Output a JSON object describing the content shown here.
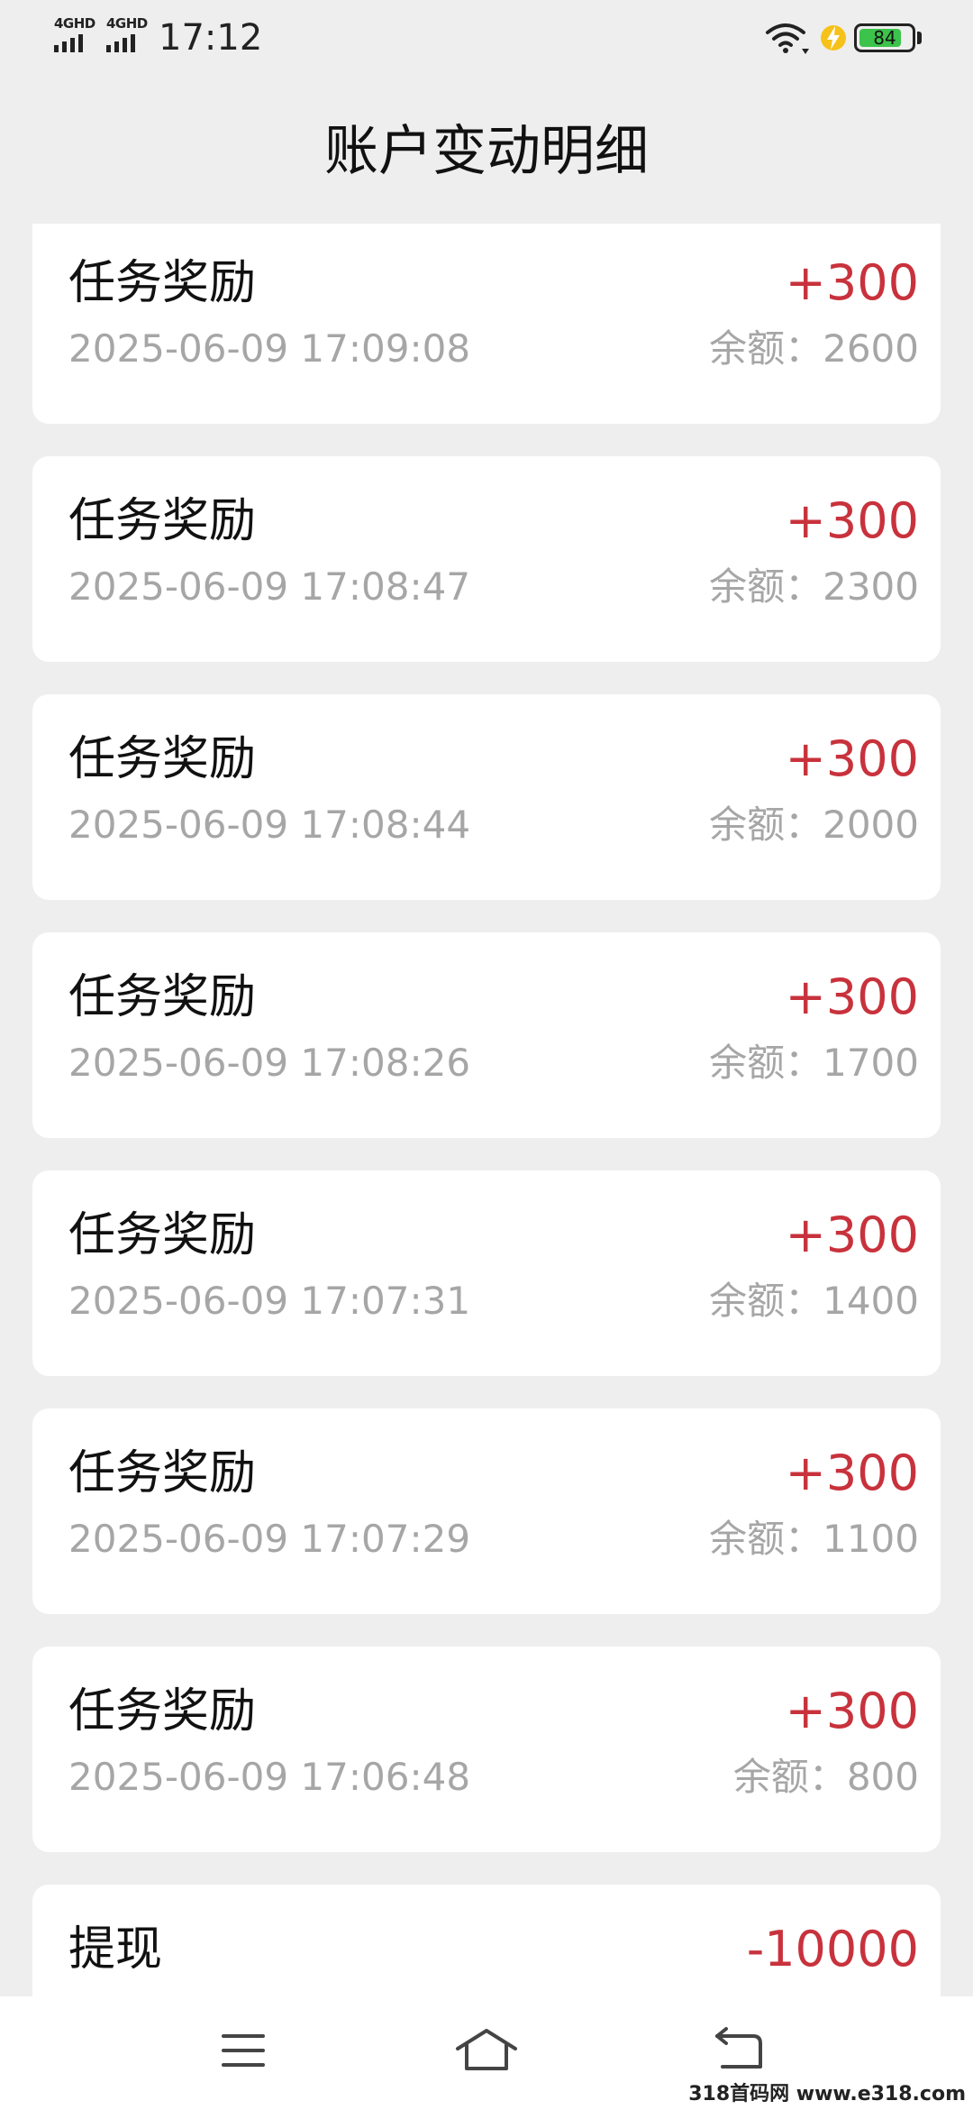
{
  "status_bar": {
    "sim1_label": "4GHD",
    "sim2_label": "4GHD",
    "time": "17:12",
    "battery_level": "84",
    "battery_fill_fraction": 0.84,
    "wifi_icon": "wifi-icon",
    "charging_icon": "lightning-icon"
  },
  "header": {
    "title": "账户变动明细"
  },
  "colors": {
    "amount": "#c8323c",
    "muted": "#a6a6a6",
    "battery": "#3cc34b"
  },
  "records": [
    {
      "type": "任务奖励",
      "amount": "+300",
      "time": "2025-06-09 17:09:08",
      "balance": "余额：2600"
    },
    {
      "type": "任务奖励",
      "amount": "+300",
      "time": "2025-06-09 17:08:47",
      "balance": "余额：2300"
    },
    {
      "type": "任务奖励",
      "amount": "+300",
      "time": "2025-06-09 17:08:44",
      "balance": "余额：2000"
    },
    {
      "type": "任务奖励",
      "amount": "+300",
      "time": "2025-06-09 17:08:26",
      "balance": "余额：1700"
    },
    {
      "type": "任务奖励",
      "amount": "+300",
      "time": "2025-06-09 17:07:31",
      "balance": "余额：1400"
    },
    {
      "type": "任务奖励",
      "amount": "+300",
      "time": "2025-06-09 17:07:29",
      "balance": "余额：1100"
    },
    {
      "type": "任务奖励",
      "amount": "+300",
      "time": "2025-06-09 17:06:48",
      "balance": "余额：800"
    },
    {
      "type": "提现",
      "amount": "-10000",
      "time": "",
      "balance": ""
    }
  ],
  "nav": {
    "menu_icon": "menu-icon",
    "home_icon": "home-icon",
    "back_icon": "back-icon"
  },
  "watermark": "318首码网 www.e318.com"
}
